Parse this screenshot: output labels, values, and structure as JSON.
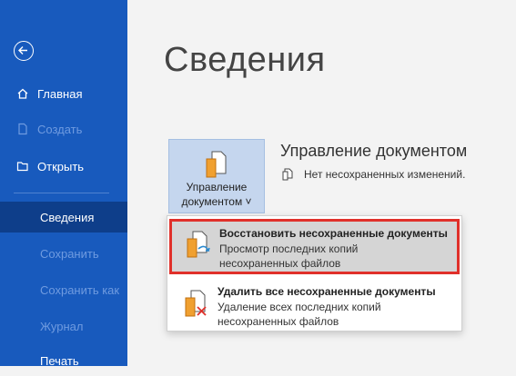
{
  "sidebar": {
    "items": [
      {
        "label": "Главная",
        "icon": "home-icon",
        "state": "normal"
      },
      {
        "label": "Создать",
        "icon": "new-document-icon",
        "state": "disabled"
      },
      {
        "label": "Открыть",
        "icon": "open-folder-icon",
        "state": "normal"
      },
      {
        "label": "Сведения",
        "icon": "",
        "state": "active"
      },
      {
        "label": "Сохранить",
        "icon": "",
        "state": "disabled"
      },
      {
        "label": "Сохранить как",
        "icon": "",
        "state": "disabled"
      },
      {
        "label": "Журнал",
        "icon": "",
        "state": "disabled"
      },
      {
        "label": "Печать",
        "icon": "",
        "state": "normal"
      }
    ]
  },
  "main": {
    "title": "Сведения",
    "manage_tile": {
      "line1": "Управление",
      "line2": "документом ˅"
    },
    "section_title": "Управление документом",
    "status": "Нет несохраненных изменений."
  },
  "menu": {
    "items": [
      {
        "title": "Восстановить несохраненные документы",
        "desc_line1": "Просмотр последних копий",
        "desc_line2": "несохраненных файлов",
        "highlighted": true
      },
      {
        "title": "Удалить все несохраненные документы",
        "desc_line1": "Удаление всех последних копий",
        "desc_line2": "несохраненных файлов",
        "highlighted": false
      }
    ]
  },
  "colors": {
    "sidebar": "#185abd",
    "active": "#0e3e8a",
    "highlight_border": "#e0302a"
  }
}
